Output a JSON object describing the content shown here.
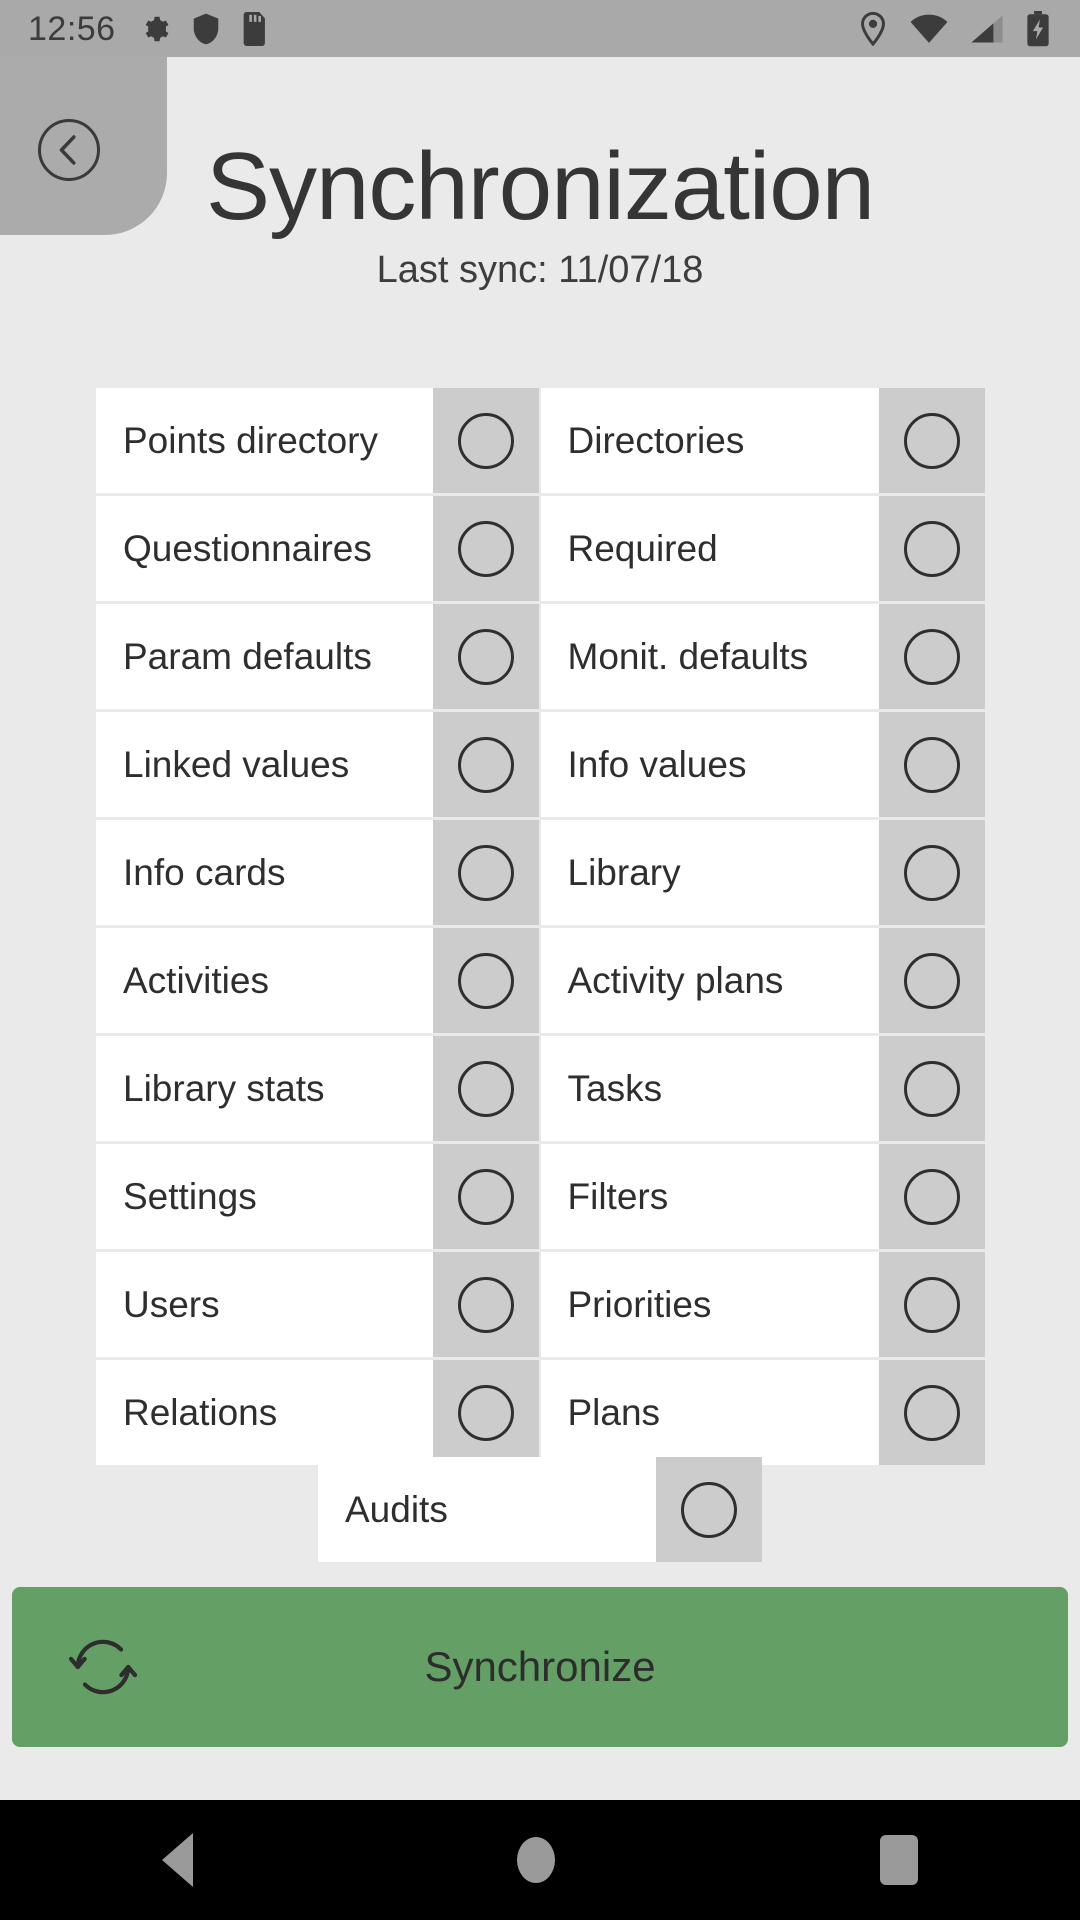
{
  "status_bar": {
    "clock": "12:56",
    "left_icons": [
      "gear-icon",
      "shield-icon",
      "sd-card-icon"
    ],
    "right_icons": [
      "location-pin-icon",
      "wifi-icon",
      "cell-signal-icon",
      "battery-charging-icon"
    ],
    "background_color": "#a9a9a9"
  },
  "header": {
    "back_label": "Back",
    "title": "Synchronization",
    "subtitle": "Last sync: 11/07/18"
  },
  "sync_table": {
    "rows": [
      {
        "left": {
          "label": "Points directory",
          "checked": false
        },
        "right": {
          "label": "Directories",
          "checked": false
        }
      },
      {
        "left": {
          "label": "Questionnaires",
          "checked": false
        },
        "right": {
          "label": "Required",
          "checked": false
        }
      },
      {
        "left": {
          "label": "Param defaults",
          "checked": false
        },
        "right": {
          "label": "Monit. defaults",
          "checked": false
        }
      },
      {
        "left": {
          "label": "Linked values",
          "checked": false
        },
        "right": {
          "label": "Info values",
          "checked": false
        }
      },
      {
        "left": {
          "label": "Info cards",
          "checked": false
        },
        "right": {
          "label": "Library",
          "checked": false
        }
      },
      {
        "left": {
          "label": "Activities",
          "checked": false
        },
        "right": {
          "label": "Activity plans",
          "checked": false
        }
      },
      {
        "left": {
          "label": "Library stats",
          "checked": false
        },
        "right": {
          "label": "Tasks",
          "checked": false
        }
      },
      {
        "left": {
          "label": "Settings",
          "checked": false
        },
        "right": {
          "label": "Filters",
          "checked": false
        }
      },
      {
        "left": {
          "label": "Users",
          "checked": false
        },
        "right": {
          "label": "Priorities",
          "checked": false
        }
      },
      {
        "left": {
          "label": "Relations",
          "checked": false
        },
        "right": {
          "label": "Plans",
          "checked": false
        }
      }
    ],
    "last_row": {
      "label": "Audits",
      "checked": false
    }
  },
  "sync_button": {
    "label": "Synchronize",
    "icon": "refresh-sync-icon",
    "color": "#64a066"
  },
  "nav_bar": {
    "back": "back-triangle-icon",
    "home": "home-circle-icon",
    "recent": "recent-square-icon"
  },
  "colors": {
    "page_background": "#eaeaea",
    "cell_background": "#ffffff",
    "checkbox_cell_background": "#cccccc",
    "accent_green": "#64a066",
    "text_primary": "#2e2e2e"
  }
}
